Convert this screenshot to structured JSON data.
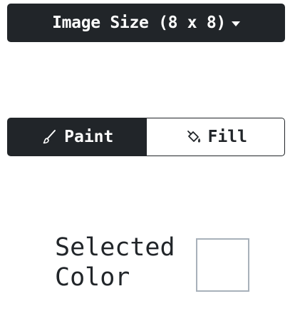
{
  "size_dropdown": {
    "label": "Image Size (8 x 8)",
    "caret_icon": "caret-down-icon"
  },
  "tools": {
    "paint": {
      "label": "Paint",
      "icon": "brush-icon",
      "active": true
    },
    "fill": {
      "label": "Fill",
      "icon": "paint-bucket-icon",
      "active": false
    }
  },
  "selected_color": {
    "label": "Selected\nColor",
    "value": "#ffffff"
  },
  "colors": {
    "dark": "#212529",
    "swatch_border": "#a8b1ba"
  }
}
